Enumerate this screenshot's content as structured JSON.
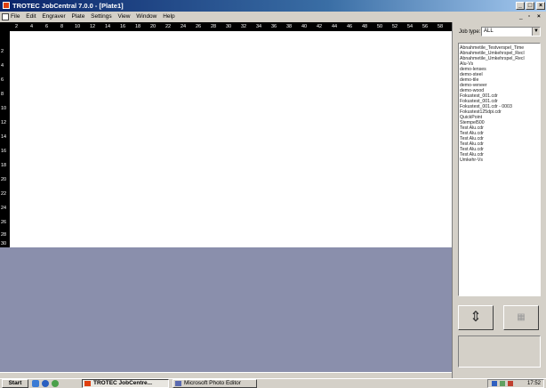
{
  "window": {
    "title": "TROTEC JobCentral 7.0.0 - [Plate1]",
    "controls": {
      "minimize": "_",
      "maximize": "□",
      "close": "×"
    },
    "mdi_controls": {
      "minimize": "_",
      "restore": "▫",
      "close": "×"
    }
  },
  "menu": [
    "File",
    "Edit",
    "Engraver",
    "Plate",
    "Settings",
    "View",
    "Window",
    "Help"
  ],
  "ruler": {
    "top_ticks": [
      "2",
      "4",
      "6",
      "8",
      "10",
      "12",
      "14",
      "16",
      "18",
      "20",
      "22",
      "24",
      "26",
      "28",
      "30",
      "32",
      "34",
      "36",
      "38",
      "40",
      "42",
      "44",
      "46",
      "48",
      "50",
      "52",
      "54",
      "56",
      "58"
    ],
    "left_ticks": [
      "2",
      "4",
      "6",
      "8",
      "10",
      "12",
      "14",
      "16",
      "18",
      "20",
      "22",
      "24",
      "26",
      "28",
      "30"
    ]
  },
  "job_panel": {
    "job_type_label": "Job type:",
    "job_type_value": "ALL",
    "jobs": [
      "Abnahmetile_Testverspel_Time",
      "Abnahmetile_Umkehrspel_Recl",
      "Abnahmetile_Umkehrspel_Recl",
      "Alu-Vs",
      "demo-lenses",
      "demo-steel",
      "demo-tile",
      "demo-veneer",
      "demo-wood",
      "Fokustest_001.cdr",
      "Fokustest_001.cdr",
      "Fokustest_001.cdr - 0003",
      "Fokustest125dpi.cdr",
      "QuickPoint",
      "Stempel500",
      "Test Alu.cdr",
      "Test Alu.cdr",
      "Test Alu.cdr",
      "Test Alu.cdr",
      "Test Alu.cdr",
      "Test Alu.cdr",
      "Umkehr-Vs"
    ],
    "buttons": {
      "move_label": "⇕",
      "delete_label": "▦"
    }
  },
  "taskbar": {
    "start_label": "Start",
    "tasks": [
      {
        "label": "TROTEC JobCentre...",
        "active": true
      },
      {
        "label": "Microsoft Photo Editor",
        "active": false
      }
    ],
    "clock": "17:52"
  },
  "colors": {
    "title_gradient_start": "#0a246a",
    "workspace_grey": "#8a8fac",
    "chrome": "#d4d0c8"
  }
}
